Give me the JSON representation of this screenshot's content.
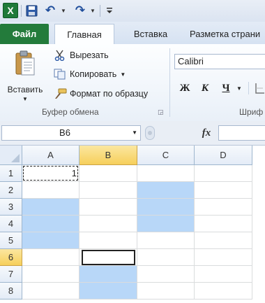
{
  "qat": {
    "app_icon_letter": "X",
    "icons": [
      "excel-app-icon",
      "save-icon",
      "undo-icon",
      "redo-icon",
      "customize-icon"
    ]
  },
  "tabs": {
    "file": "Файл",
    "home": "Главная",
    "insert": "Вставка",
    "layout": "Разметка страни"
  },
  "ribbon": {
    "clipboard": {
      "paste": "Вставить",
      "cut": "Вырезать",
      "copy": "Копировать",
      "format_painter": "Формат по образцу",
      "group_label": "Буфер обмена"
    },
    "font": {
      "name": "Calibri",
      "bold": "Ж",
      "italic": "К",
      "underline": "Ч",
      "group_label": "Шриф"
    }
  },
  "formula_bar": {
    "name_box": "B6",
    "fx": "fx",
    "value": ""
  },
  "sheet": {
    "columns": [
      "A",
      "B",
      "C",
      "D"
    ],
    "rows": [
      "1",
      "2",
      "3",
      "4",
      "5",
      "6",
      "7",
      "8"
    ],
    "cells": {
      "A1": "1"
    },
    "selected_cells": [
      "A3",
      "A4",
      "A5",
      "C2",
      "C3",
      "C4",
      "B7",
      "B8"
    ],
    "active_cell": "B6",
    "copy_marquee": "A1"
  },
  "colors": {
    "file_tab": "#237b3b",
    "selection": "#b8d7f8",
    "header_highlight": "#f6cf5b"
  }
}
